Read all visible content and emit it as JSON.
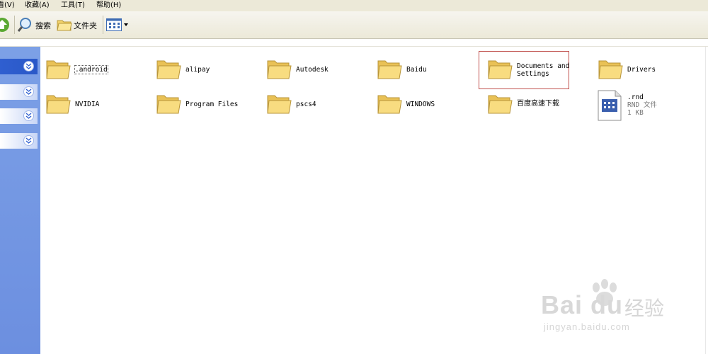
{
  "menu": [
    "看(V)",
    "收藏(A)",
    "工具(T)",
    "帮助(H)"
  ],
  "toolbar": {
    "search_label": "搜索",
    "folders_label": "文件夹"
  },
  "files": [
    {
      "name": ".android",
      "type": "folder"
    },
    {
      "name": "alipay",
      "type": "folder"
    },
    {
      "name": "Autodesk",
      "type": "folder"
    },
    {
      "name": "Baidu",
      "type": "folder"
    },
    {
      "name": "Documents and\nSettings",
      "type": "folder",
      "highlighted": true
    },
    {
      "name": "Drivers",
      "type": "folder"
    },
    {
      "name": "NVIDIA",
      "type": "folder"
    },
    {
      "name": "Program Files",
      "type": "folder"
    },
    {
      "name": "pscs4",
      "type": "folder"
    },
    {
      "name": "WINDOWS",
      "type": "folder"
    },
    {
      "name": "百度高速下载",
      "type": "folder"
    },
    {
      "name": ".rnd",
      "type": "file",
      "file_type": "RND 文件",
      "size": "1 KB"
    }
  ],
  "watermark": {
    "brand": "Bai du",
    "cn": "经验",
    "url": "jingyan.baidu.com"
  },
  "colors": {
    "task_pane": "#7ca0e6",
    "highlight_border": "#c0504d",
    "folder": "#f5d56b"
  }
}
